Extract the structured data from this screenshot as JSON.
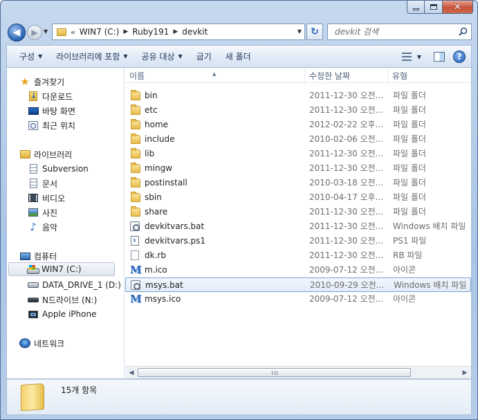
{
  "address": {
    "overflow": "«",
    "crumbs": [
      "WIN7 (C:)",
      "Ruby191",
      "devkit"
    ]
  },
  "search": {
    "placeholder": "devkit 검색"
  },
  "toolbar": {
    "organize": "구성",
    "include_library": "라이브러리에 포함",
    "share": "공유 대상",
    "burn": "굽기",
    "new_folder": "새 폴더"
  },
  "nav": {
    "favorites": "즐겨찾기",
    "downloads": "다운로드",
    "desktop": "바탕 화면",
    "recent": "최근 위치",
    "libraries": "라이브러리",
    "subversion": "Subversion",
    "documents": "문서",
    "videos": "비디오",
    "pictures": "사진",
    "music": "음악",
    "computer": "컴퓨터",
    "drive_c": "WIN7 (C:)",
    "drive_d": "DATA_DRIVE_1 (D:)",
    "drive_n": "N드라이브 (N:)",
    "iphone": "Apple iPhone",
    "network": "네트워크"
  },
  "columns": {
    "name": "이름",
    "date": "수정한 날짜",
    "type": "유형"
  },
  "files": [
    {
      "name": "bin",
      "date": "2011-12-30 오전...",
      "type": "파일 폴더",
      "icon": "folder-icon"
    },
    {
      "name": "etc",
      "date": "2011-12-30 오전...",
      "type": "파일 폴더",
      "icon": "folder-icon"
    },
    {
      "name": "home",
      "date": "2012-02-22 오후...",
      "type": "파일 폴더",
      "icon": "folder-icon"
    },
    {
      "name": "include",
      "date": "2010-02-06 오전...",
      "type": "파일 폴더",
      "icon": "folder-icon"
    },
    {
      "name": "lib",
      "date": "2011-12-30 오전...",
      "type": "파일 폴더",
      "icon": "folder-icon"
    },
    {
      "name": "mingw",
      "date": "2011-12-30 오전...",
      "type": "파일 폴더",
      "icon": "folder-icon"
    },
    {
      "name": "postinstall",
      "date": "2010-03-18 오전...",
      "type": "파일 폴더",
      "icon": "folder-icon"
    },
    {
      "name": "sbin",
      "date": "2010-04-17 오후...",
      "type": "파일 폴더",
      "icon": "folder-icon"
    },
    {
      "name": "share",
      "date": "2011-12-30 오전...",
      "type": "파일 폴더",
      "icon": "folder-icon"
    },
    {
      "name": "devkitvars.bat",
      "date": "2011-12-30 오전...",
      "type": "Windows 배치 파일",
      "icon": "batch-file-icon"
    },
    {
      "name": "devkitvars.ps1",
      "date": "2011-12-30 오전...",
      "type": "PS1 파일",
      "icon": "ps1-file-icon"
    },
    {
      "name": "dk.rb",
      "date": "2011-12-30 오전...",
      "type": "RB 파일",
      "icon": "blank-file-icon"
    },
    {
      "name": "m.ico",
      "date": "2009-07-12 오전...",
      "type": "아이콘",
      "icon": "msys-icon"
    },
    {
      "name": "msys.bat",
      "date": "2010-09-29 오전...",
      "type": "Windows 배치 파일",
      "icon": "batch-file-icon"
    },
    {
      "name": "msys.ico",
      "date": "2009-07-12 오전...",
      "type": "아이콘",
      "icon": "msys-icon"
    }
  ],
  "status": {
    "item_count": "15개 항목"
  }
}
